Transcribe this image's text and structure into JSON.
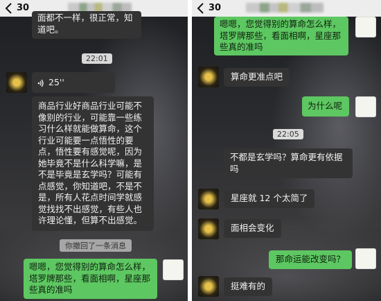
{
  "left_screen": {
    "unread_count": "30",
    "messages": {
      "top_fragment": "面都不一样，很正常，知道吧。",
      "time_1": "22:01",
      "voice_duration": "25''",
      "long_text": "商品行业好商品行业可能不像别的行业，可能靠一些练习什么样就能做算命，这个行业可能要一点悟性的要点，悟性要有感觉呢，因为她毕竟不是什么科学嘛，是不是毕竟是玄学吗？可能有点感觉，你知道吧，不是不是，所有人花点时间学就感觉找找不出感觉，有些人也许理论懂，但算不出感觉。",
      "recall_notice": "你撤回了一条消息",
      "last_sent": "嗯嗯，您觉得别的算命怎么样，塔罗牌那些，看面相啊，星座那些真的准吗"
    }
  },
  "right_screen": {
    "unread_count": "30",
    "messages": {
      "first_sent": "嗯嗯，您觉得别的算命怎么样，塔罗牌那些，看面相啊，星座那些真的准吗",
      "reply_1": "算命更准点吧",
      "sent_2": "为什么呢",
      "time_1": "22:05",
      "reply_2": "不都是玄学吗？算命更有依据吗",
      "reply_3": "星座就 12 个太简了",
      "reply_4": "面相会变化",
      "sent_3": "那命运能改变吗？",
      "reply_5": "挺难有的"
    }
  }
}
